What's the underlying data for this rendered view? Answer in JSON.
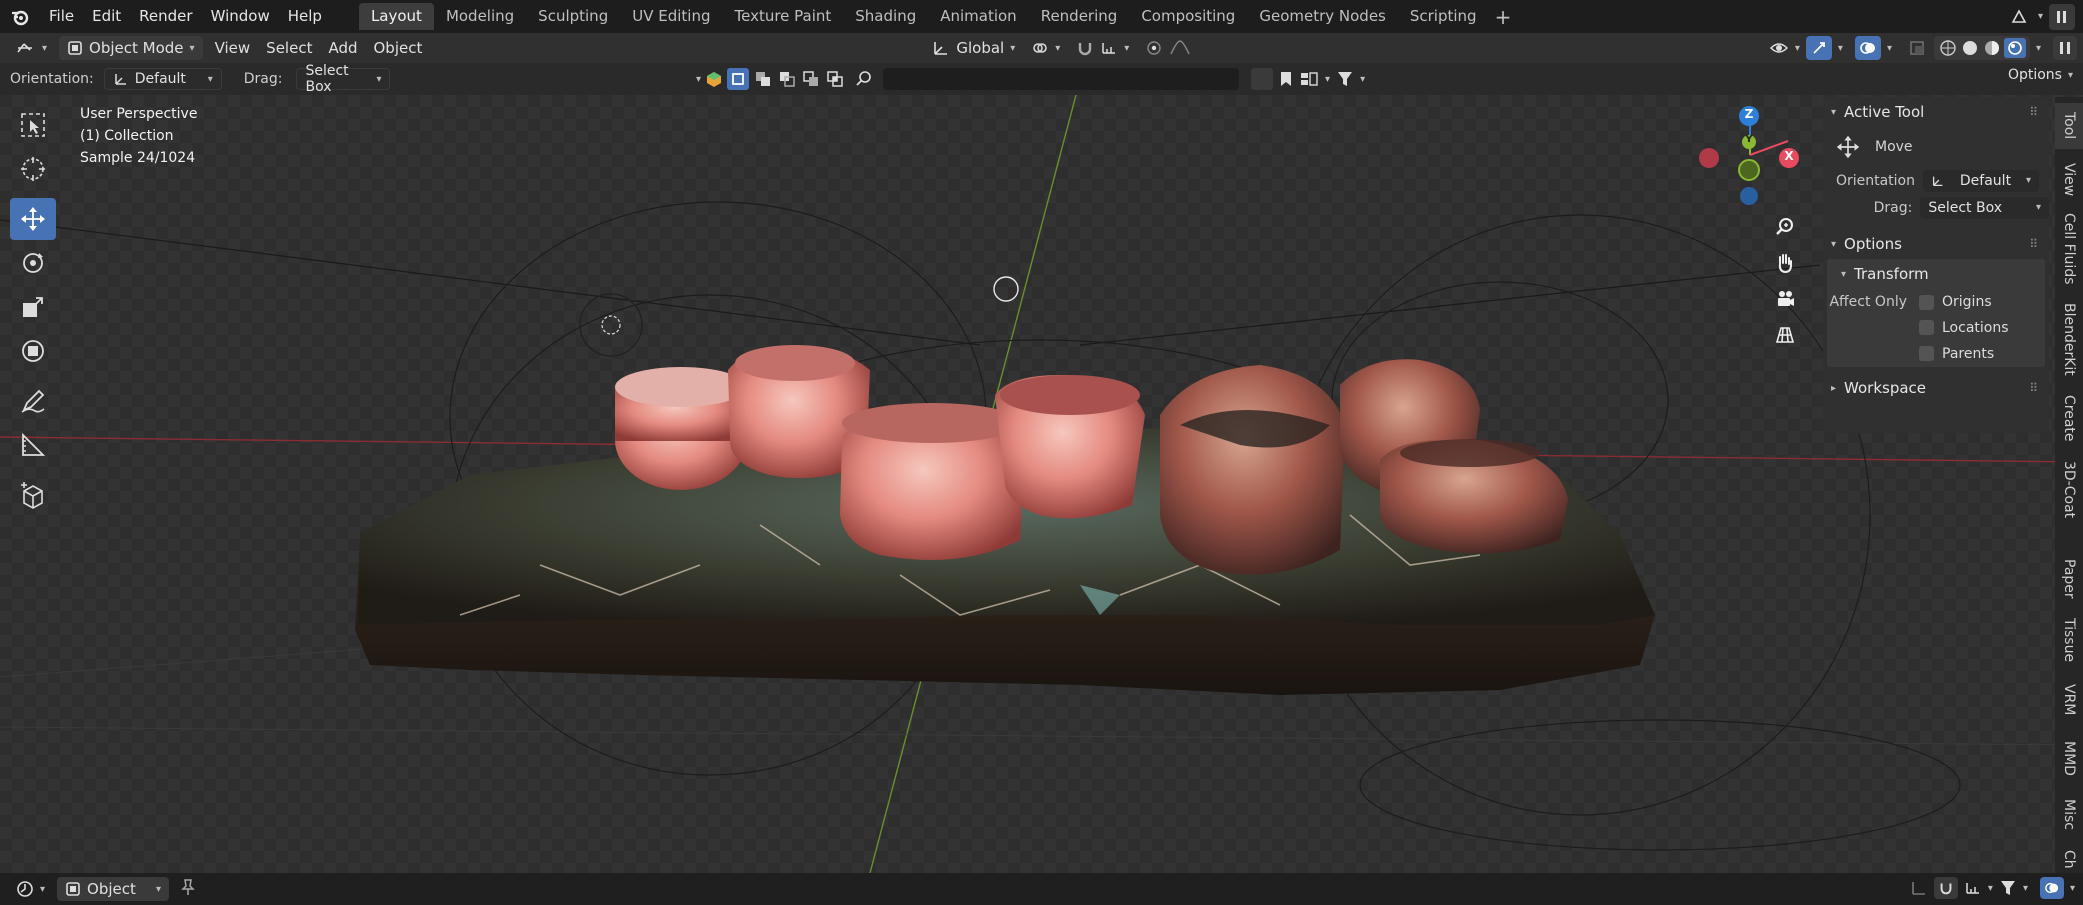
{
  "menu": {
    "file": "File",
    "edit": "Edit",
    "render": "Render",
    "window": "Window",
    "help": "Help"
  },
  "workspaces": [
    "Layout",
    "Modeling",
    "Sculpting",
    "UV Editing",
    "Texture Paint",
    "Shading",
    "Animation",
    "Rendering",
    "Compositing",
    "Geometry Nodes",
    "Scripting"
  ],
  "header": {
    "mode": "Object Mode",
    "view": "View",
    "select": "Select",
    "add": "Add",
    "object": "Object",
    "transform_orientation": "Global",
    "options": "Options"
  },
  "tool_settings": {
    "orientation_label": "Orientation:",
    "orientation_value": "Default",
    "drag_label": "Drag:",
    "drag_value": "Select Box"
  },
  "viewport": {
    "perspective": "User Perspective",
    "collection": "(1) Collection",
    "sample": "Sample 24/1024"
  },
  "gizmo": {
    "z": "Z",
    "y": "Y",
    "x": "X"
  },
  "sidebar": {
    "active_tool_title": "Active Tool",
    "tool_name": "Move",
    "orientation_label": "Orientation",
    "orientation_value": "Default",
    "drag_label": "Drag:",
    "drag_value": "Select Box",
    "options_title": "Options",
    "transform_title": "Transform",
    "affect_only_label": "Affect Only",
    "origins": "Origins",
    "locations": "Locations",
    "parents": "Parents",
    "workspace_title": "Workspace"
  },
  "vertical_tabs": [
    "Tool",
    "View",
    "Cell Fluids",
    "BlenderKit",
    "Create",
    "3D-Coat",
    "Paper",
    "Tissue",
    "VRM",
    "MMD",
    "Misc",
    "Ch"
  ],
  "statusbar": {
    "mode": "Object"
  },
  "colors": {
    "accent": "#4772b3",
    "axis_x": "#e84a5f",
    "axis_y": "#8ab834",
    "axis_z": "#2e7fd8"
  }
}
